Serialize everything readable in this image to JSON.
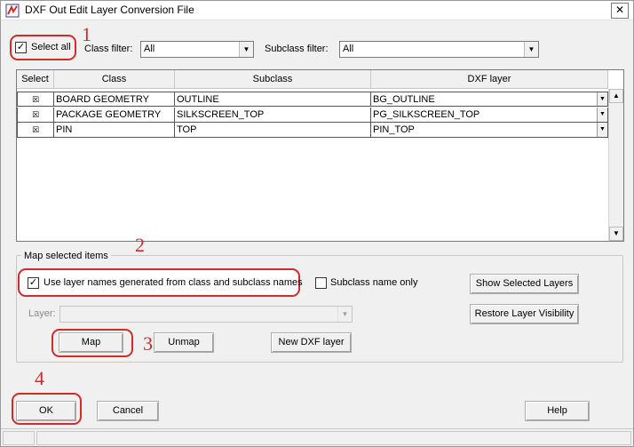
{
  "window": {
    "title": "DXF Out Edit Layer Conversion File",
    "close_glyph": "✕"
  },
  "filters": {
    "select_all_label": "Select all",
    "select_all_checked": true,
    "class_filter_label": "Class filter:",
    "class_filter_value": "All",
    "subclass_filter_label": "Subclass filter:",
    "subclass_filter_value": "All"
  },
  "table": {
    "columns": [
      "Select",
      "Class",
      "Subclass",
      "DXF layer"
    ],
    "rows": [
      {
        "select": "☒",
        "class": "BOARD GEOMETRY",
        "subclass": "OUTLINE",
        "dxf_layer": "BG_OUTLINE"
      },
      {
        "select": "☒",
        "class": "PACKAGE GEOMETRY",
        "subclass": "SILKSCREEN_TOP",
        "dxf_layer": "PG_SILKSCREEN_TOP"
      },
      {
        "select": "☒",
        "class": "PIN",
        "subclass": "TOP",
        "dxf_layer": "PIN_TOP"
      }
    ]
  },
  "map_group": {
    "title": "Map selected items",
    "use_layer_names_label": "Use layer names generated from class and subclass names",
    "use_layer_names_checked": true,
    "subclass_only_label": "Subclass name only",
    "subclass_only_checked": false,
    "layer_label": "Layer:",
    "layer_value": "",
    "map_button": "Map",
    "unmap_button": "Unmap",
    "new_dxf_layer_button": "New DXF layer",
    "show_selected_layers_button": "Show Selected Layers",
    "restore_layer_visibility_button": "Restore Layer Visibility"
  },
  "footer": {
    "ok_button": "OK",
    "cancel_button": "Cancel",
    "help_button": "Help"
  },
  "annotations": {
    "marker_1": "1",
    "marker_2": "2",
    "marker_3": "3",
    "marker_4": "4",
    "color": "#d42a2a"
  },
  "icons": {
    "app": "dxf-app-icon",
    "dropdown": "▼",
    "scroll_up": "▲",
    "scroll_down": "▼",
    "check": "✓"
  }
}
